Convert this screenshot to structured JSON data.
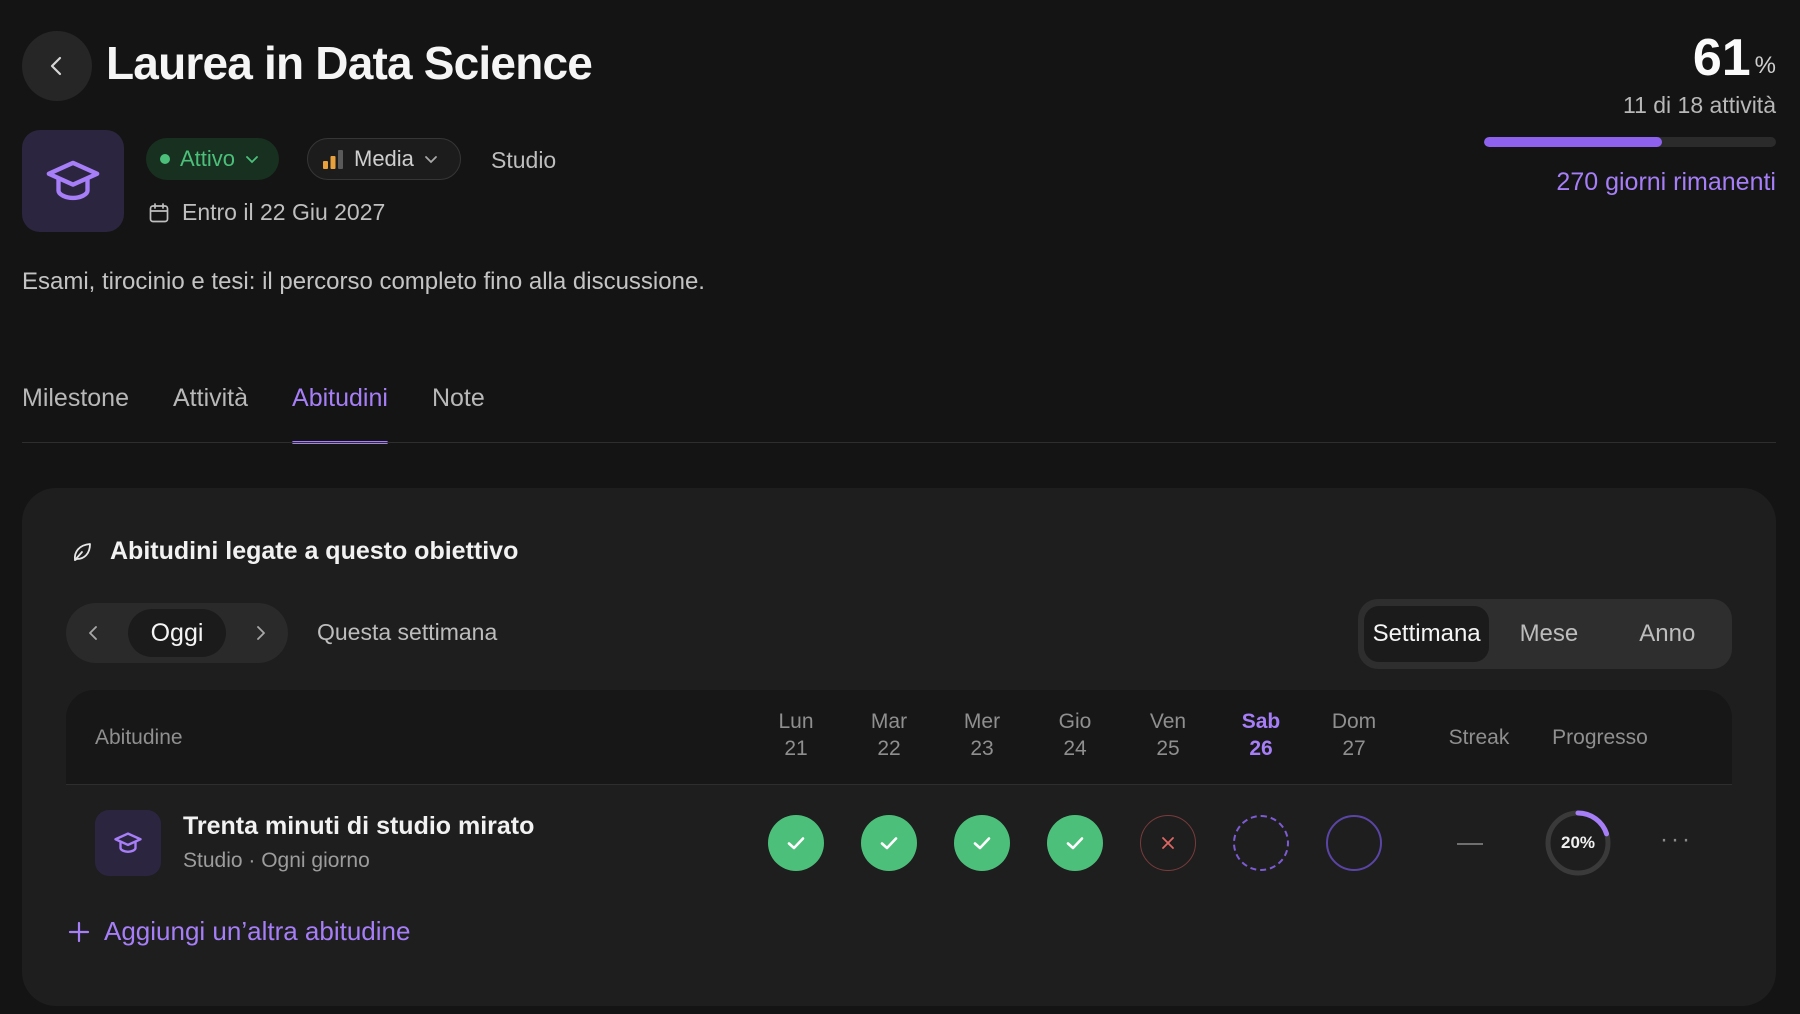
{
  "header": {
    "title": "Laurea in Data Science",
    "status": {
      "label": "Attivo",
      "color": "#4cc07a"
    },
    "priority": {
      "label": "Media"
    },
    "category": "Studio",
    "due_date": "Entro il 22 Giu 2027",
    "description": "Esami, tirocinio e tesi: il percorso completo fino alla discussione."
  },
  "progress": {
    "percent_value": "61",
    "percent_sign": "%",
    "fraction": 0.61,
    "activities_label": "11 di 18 attività",
    "days_left_label": "270 giorni rimanenti",
    "accent_color": "#a67ef7"
  },
  "tabs": [
    {
      "label": "Milestone",
      "active": false
    },
    {
      "label": "Attività",
      "active": false
    },
    {
      "label": "Abitudini",
      "active": true
    },
    {
      "label": "Note",
      "active": false
    }
  ],
  "habits_card": {
    "title": "Abitudini legate a questo obiettivo",
    "title_icon": "leaf-icon",
    "nav": {
      "today_label": "Oggi",
      "period_label": "Questa settimana"
    },
    "range": [
      {
        "label": "Settimana",
        "active": true
      },
      {
        "label": "Mese",
        "active": false
      },
      {
        "label": "Anno",
        "active": false
      }
    ],
    "columns": {
      "habit": "Abitudine",
      "days": [
        {
          "name": "Lun",
          "num": "21",
          "today": false
        },
        {
          "name": "Mar",
          "num": "22",
          "today": false
        },
        {
          "name": "Mer",
          "num": "23",
          "today": false
        },
        {
          "name": "Gio",
          "num": "24",
          "today": false
        },
        {
          "name": "Ven",
          "num": "25",
          "today": false
        },
        {
          "name": "Sab",
          "num": "26",
          "today": true
        },
        {
          "name": "Dom",
          "num": "27",
          "today": false
        }
      ],
      "streak": "Streak",
      "progress": "Progresso"
    },
    "rows": [
      {
        "name": "Trenta minuti di studio mirato",
        "meta": "Studio · Ogni giorno",
        "icon": "graduation-cap-icon",
        "days": [
          "done",
          "done",
          "done",
          "done",
          "missed",
          "today",
          "future"
        ],
        "streak": "—",
        "progress_label": "20%",
        "progress_fraction": 0.2
      }
    ],
    "add_label": "Aggiungi un’altra abitudine"
  }
}
